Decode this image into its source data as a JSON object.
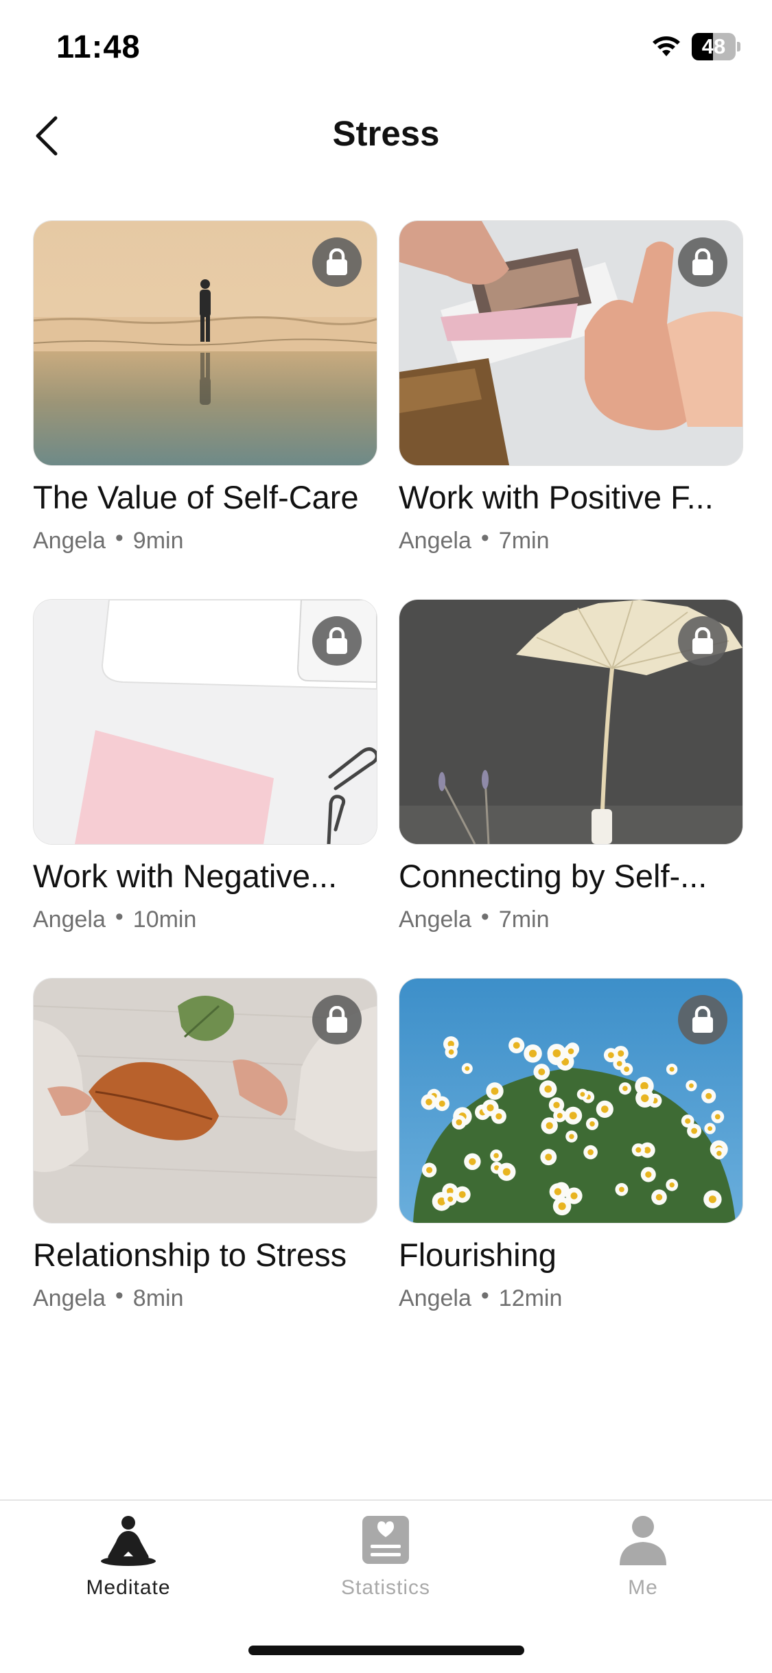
{
  "status_bar": {
    "time": "11:48",
    "battery_level": "48",
    "battery_fraction": 0.48,
    "icons": [
      "wifi-icon",
      "battery-icon"
    ]
  },
  "header": {
    "title": "Stress",
    "back_icon": "chevron-left-icon"
  },
  "cards": [
    {
      "title": "The Value of Self-Care",
      "author": "Angela",
      "duration": "9min",
      "separator": "•",
      "locked": true,
      "image": "person-on-beach-reflection"
    },
    {
      "title": "Work with Positive F...",
      "author": "Angela",
      "duration": "7min",
      "separator": "•",
      "locked": true,
      "image": "thumbs-up-photos"
    },
    {
      "title": "Work with Negative...",
      "author": "Angela",
      "duration": "10min",
      "separator": "•",
      "locked": true,
      "image": "desk-pink-notepad-paperclips"
    },
    {
      "title": "Connecting by Self-...",
      "author": "Angela",
      "duration": "7min",
      "separator": "•",
      "locked": true,
      "image": "dried-palm-leaf-vase"
    },
    {
      "title": "Relationship to Stress",
      "author": "Angela",
      "duration": "8min",
      "separator": "•",
      "locked": true,
      "image": "hands-holding-autumn-leaves"
    },
    {
      "title": "Flourishing",
      "author": "Angela",
      "duration": "12min",
      "separator": "•",
      "locked": true,
      "image": "chamomile-bouquet-blue-sky"
    }
  ],
  "tab_bar": {
    "tabs": [
      {
        "label": "Meditate",
        "icon": "meditate-icon",
        "active": true
      },
      {
        "label": "Statistics",
        "icon": "statistics-icon",
        "active": false
      },
      {
        "label": "Me",
        "icon": "person-icon",
        "active": false
      }
    ],
    "active_color": "#1e1e1e",
    "inactive_color": "#a9a9a9"
  }
}
